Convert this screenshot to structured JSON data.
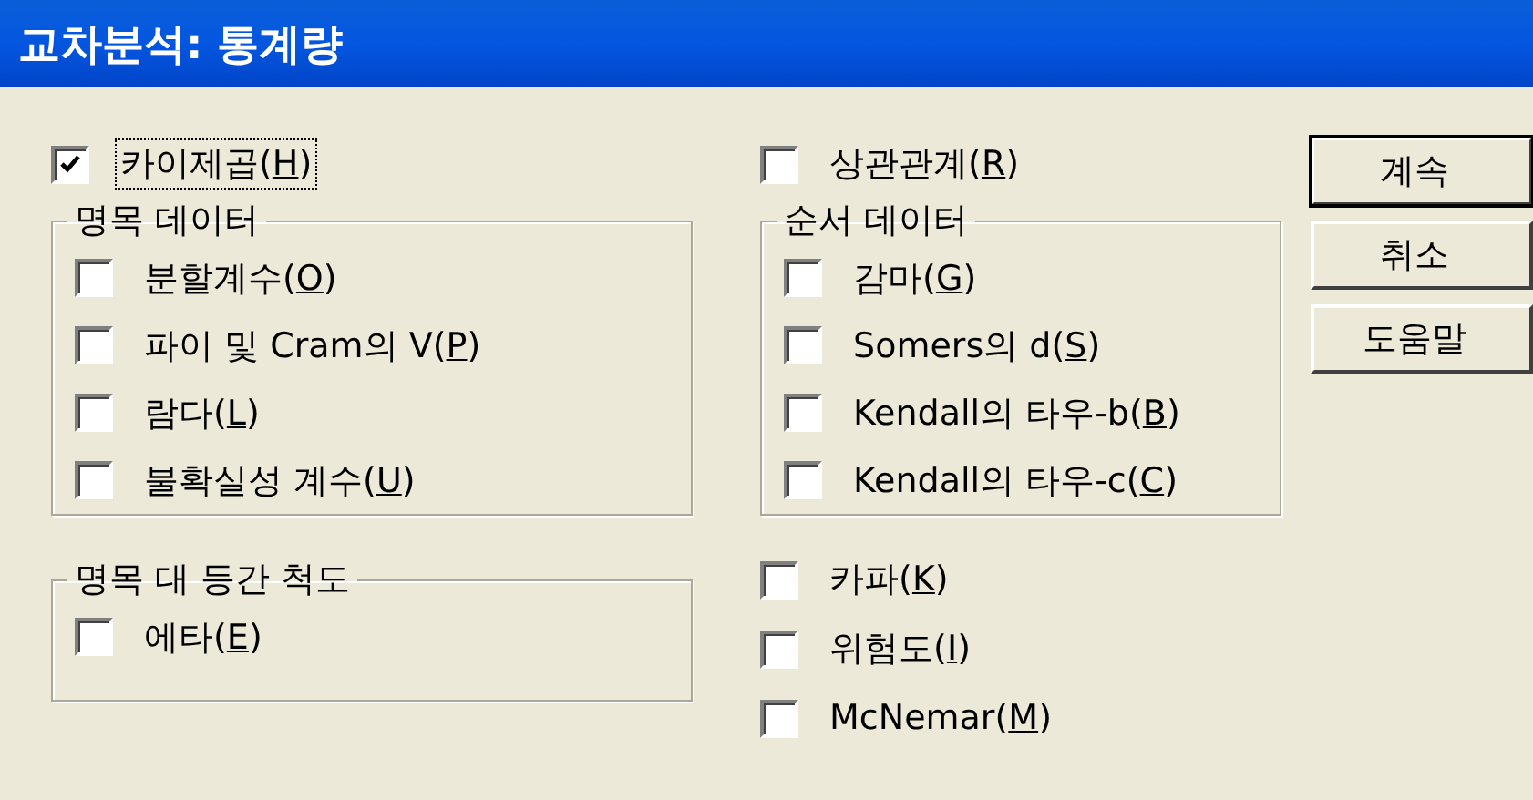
{
  "window": {
    "title": "교차분석: 통계량"
  },
  "chi_square": {
    "label": "카이제곱(H)",
    "checked": true,
    "focused": true
  },
  "correlations": {
    "label": "상관관계(R)",
    "checked": false
  },
  "nominal": {
    "title": "명목 데이터",
    "items": [
      {
        "label": "분할계수(O)",
        "checked": false
      },
      {
        "label": "파이 및 Cram의 V(P)",
        "checked": false
      },
      {
        "label": "람다(L)",
        "checked": false
      },
      {
        "label": "불확실성 계수(U)",
        "checked": false
      }
    ]
  },
  "ordinal": {
    "title": "순서 데이터",
    "items": [
      {
        "label": "감마(G)",
        "checked": false
      },
      {
        "label": "Somers의 d(S)",
        "checked": false
      },
      {
        "label": "Kendall의 타우-b(B)",
        "checked": false
      },
      {
        "label": "Kendall의 타우-c(C)",
        "checked": false
      }
    ]
  },
  "nominal_by_interval": {
    "title": "명목 대 등간 척도",
    "items": [
      {
        "label": "에타(E)",
        "checked": false
      }
    ]
  },
  "other_items": [
    {
      "label": "카파(K)",
      "checked": false
    },
    {
      "label": "위험도(I)",
      "checked": false
    },
    {
      "label": "McNemar(M)",
      "checked": false
    }
  ],
  "buttons": [
    {
      "label": "계속",
      "default": true
    },
    {
      "label": "취소",
      "default": false
    },
    {
      "label": "도움말",
      "default": false
    }
  ]
}
